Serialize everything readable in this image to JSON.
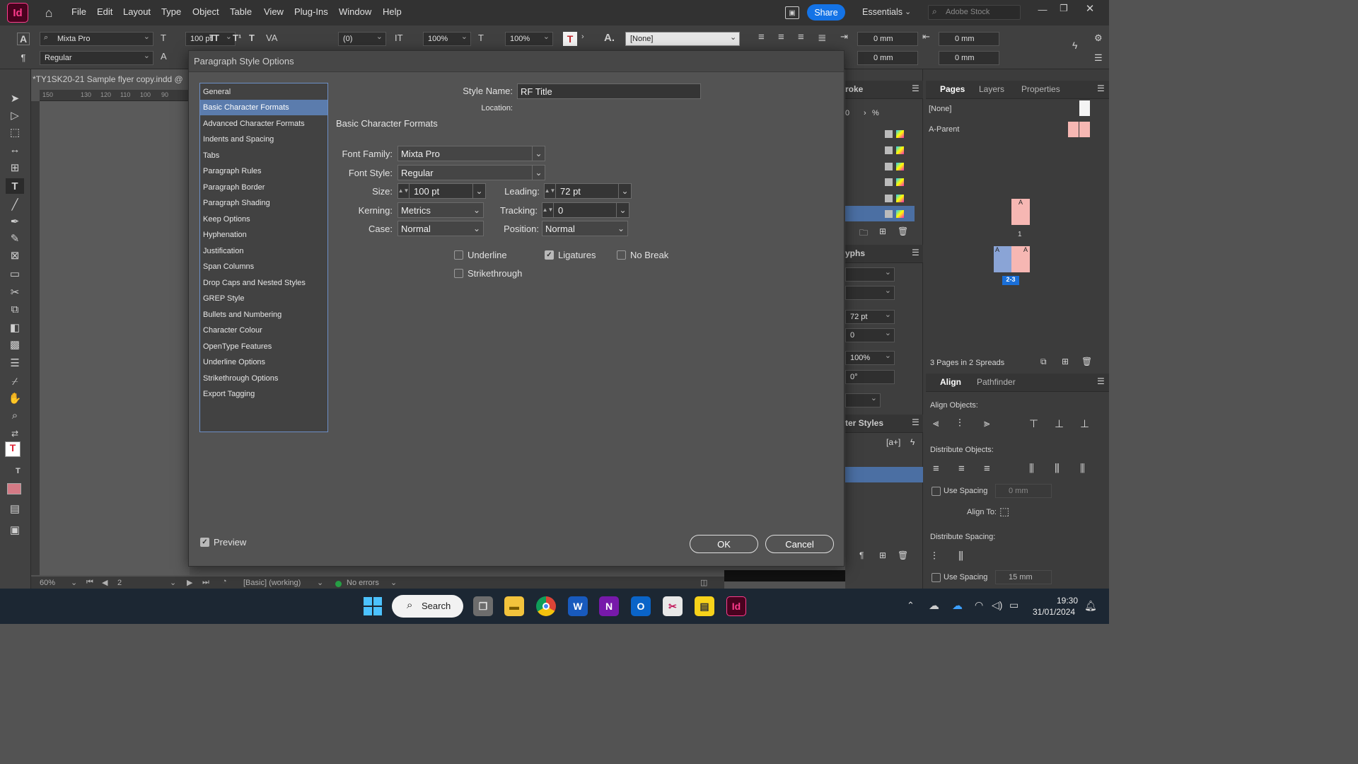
{
  "app": {
    "logo": "Id"
  },
  "menu": [
    "File",
    "Edit",
    "Layout",
    "Type",
    "Object",
    "Table",
    "View",
    "Plug-Ins",
    "Window",
    "Help"
  ],
  "topbar": {
    "share": "Share",
    "workspace": "Essentials",
    "stock_placeholder": "Adobe Stock"
  },
  "control": {
    "font": "Mixta Pro",
    "style": "Regular",
    "size": "100 pt",
    "kern": "(0)",
    "vscale": "100%",
    "hscale": "100%",
    "char_style": "[None]",
    "indent1": "0 mm",
    "indent2": "0 mm",
    "indent3": "0 mm",
    "indent4": "0 mm"
  },
  "document": {
    "tab": "*TY1SK20-21 Sample flyer copy.indd @",
    "ruler": [
      "150",
      "130",
      "120",
      "110",
      "100",
      "90"
    ]
  },
  "status": {
    "zoom": "60%",
    "page": "2",
    "profile": "[Basic] (working)",
    "errors": "No errors"
  },
  "dialog": {
    "title": "Paragraph Style Options",
    "categories": [
      "General",
      "Basic Character Formats",
      "Advanced Character Formats",
      "Indents and Spacing",
      "Tabs",
      "Paragraph Rules",
      "Paragraph Border",
      "Paragraph Shading",
      "Keep Options",
      "Hyphenation",
      "Justification",
      "Span Columns",
      "Drop Caps and Nested Styles",
      "GREP Style",
      "Bullets and Numbering",
      "Character Colour",
      "OpenType Features",
      "Underline Options",
      "Strikethrough Options",
      "Export Tagging"
    ],
    "style_name_label": "Style Name:",
    "style_name": "RF Title",
    "location_label": "Location:",
    "section": "Basic Character Formats",
    "font_family_label": "Font Family:",
    "font_family": "Mixta Pro",
    "font_style_label": "Font Style:",
    "font_style": "Regular",
    "size_label": "Size:",
    "size": "100 pt",
    "leading_label": "Leading:",
    "leading": "72 pt",
    "kerning_label": "Kerning:",
    "kerning": "Metrics",
    "tracking_label": "Tracking:",
    "tracking": "0",
    "case_label": "Case:",
    "case": "Normal",
    "position_label": "Position:",
    "position": "Normal",
    "underline": "Underline",
    "ligatures": "Ligatures",
    "nobreak": "No Break",
    "strikethrough": "Strikethrough",
    "preview": "Preview",
    "ok": "OK",
    "cancel": "Cancel"
  },
  "panels": {
    "stroke": "roke",
    "glyphs": "yphs",
    "charstyles": "ter Styles",
    "pages_tab": "Pages",
    "layers_tab": "Layers",
    "properties_tab": "Properties",
    "none_master": "[None]",
    "parent_master": "A-Parent",
    "page1": "1",
    "spread": "2-3",
    "master_letter": "A",
    "pages_count": "3 Pages in 2 Spreads",
    "pct": "%",
    "zero": "0",
    "leading_val": "72 pt",
    "track_val": "0",
    "scale_val": "100%",
    "angle_val": "0°",
    "align_tab": "Align",
    "pathfinder_tab": "Pathfinder",
    "align_objects": "Align Objects:",
    "distribute_objects": "Distribute Objects:",
    "use_spacing": "Use Spacing",
    "spacing1": "0 mm",
    "align_to": "Align To:",
    "distribute_spacing": "Distribute Spacing:",
    "spacing2": "15 mm"
  },
  "taskbar": {
    "search": "Search",
    "time": "19:30",
    "date": "31/01/2024"
  }
}
